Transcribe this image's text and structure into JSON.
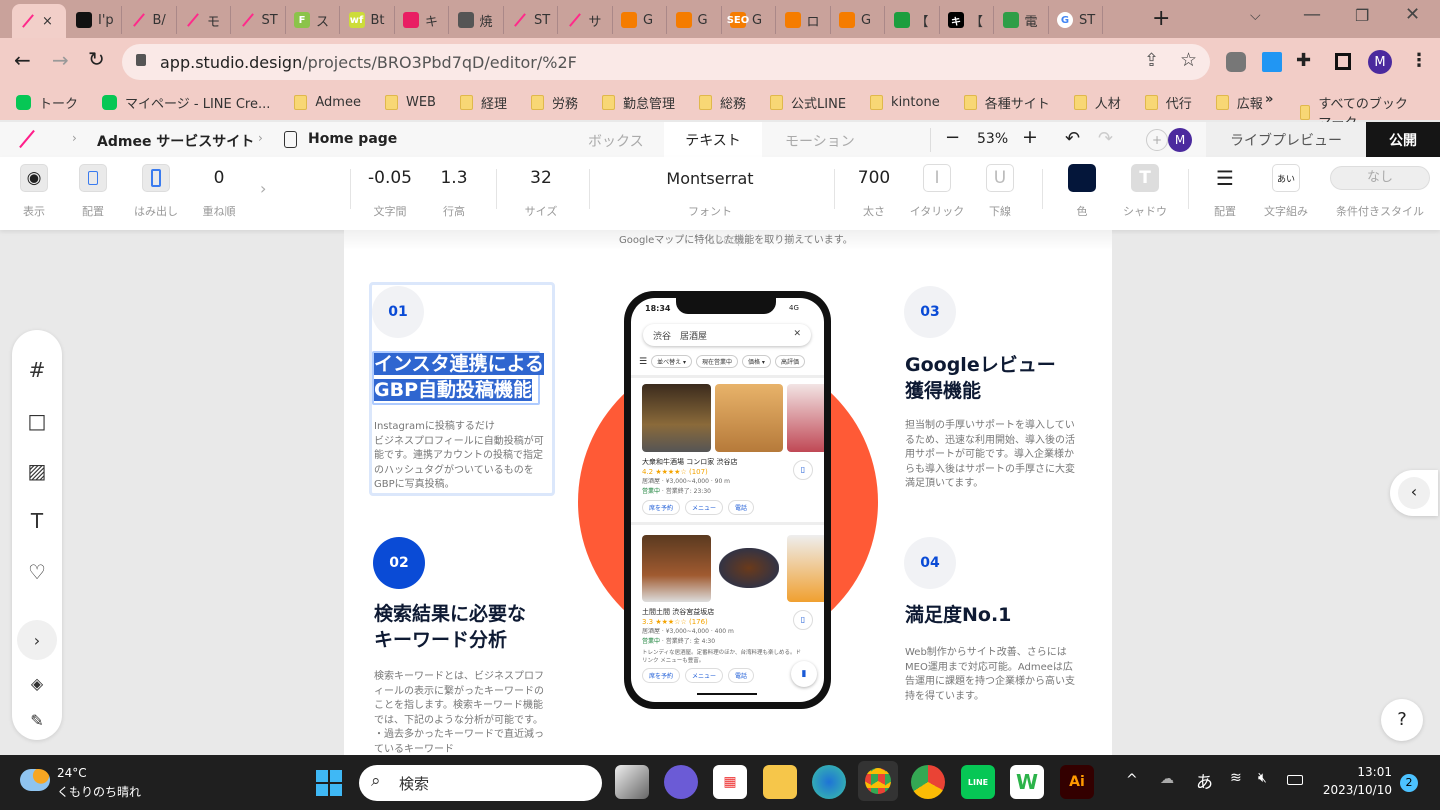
{
  "browser": {
    "tabs": [
      {
        "label": "×",
        "icon": "studio-icon",
        "color": "#ff2a8a"
      },
      {
        "label": "I'p",
        "icon": "dark-site-icon",
        "color": "#111"
      },
      {
        "label": "B/",
        "icon": "studio-icon",
        "color": "#ff2a8a"
      },
      {
        "label": "モ",
        "icon": "studio-icon",
        "color": "#ff2a8a"
      },
      {
        "label": "ST",
        "icon": "studio-icon",
        "color": "#ff2a8a"
      },
      {
        "label": "ス",
        "icon": "F",
        "color": "#8bc34a"
      },
      {
        "label": "Bt",
        "icon": "wf",
        "color": "#cddc39"
      },
      {
        "label": "キ",
        "icon": "pen-icon",
        "color": "#e91e63"
      },
      {
        "label": "焼",
        "icon": "tree-icon",
        "color": "#555"
      },
      {
        "label": "ST",
        "icon": "studio-icon",
        "color": "#ff2a8a"
      },
      {
        "label": "サ",
        "icon": "studio-icon",
        "color": "#ff2a8a"
      },
      {
        "label": "G",
        "icon": "orange-doc-icon",
        "color": "#f57c00"
      },
      {
        "label": "G",
        "icon": "orange-doc-icon",
        "color": "#f57c00"
      },
      {
        "label": "G",
        "icon": "SEO",
        "color": "#f57c00"
      },
      {
        "label": "ロ",
        "icon": "orange-doc-icon",
        "color": "#f57c00"
      },
      {
        "label": "G",
        "icon": "orange-doc-icon",
        "color": "#f57c00"
      },
      {
        "label": "【",
        "icon": "green-cross-icon",
        "color": "#1b9e3e"
      },
      {
        "label": "【",
        "icon": "キ",
        "color": "#000"
      },
      {
        "label": "電",
        "icon": "phone-icon",
        "color": "#2e9e47"
      },
      {
        "label": "ST",
        "icon": "google-icon",
        "color": "#fff"
      }
    ],
    "new_tab": "+",
    "url_host": "app.studio.design",
    "url_path": "/projects/BRO3Pbd7qD/editor/%2F",
    "profile_initial": "M",
    "bookmarks": [
      {
        "label": "トーク",
        "icon": "line-chat-icon"
      },
      {
        "label": "マイページ - LINE Cre...",
        "icon": "line-icon"
      },
      {
        "label": "Admee",
        "icon": "folder-icon"
      },
      {
        "label": "WEB",
        "icon": "folder-icon"
      },
      {
        "label": "経理",
        "icon": "folder-icon"
      },
      {
        "label": "労務",
        "icon": "folder-icon"
      },
      {
        "label": "勤怠管理",
        "icon": "folder-icon"
      },
      {
        "label": "総務",
        "icon": "folder-icon"
      },
      {
        "label": "公式LINE",
        "icon": "folder-icon"
      },
      {
        "label": "kintone",
        "icon": "folder-icon"
      },
      {
        "label": "各種サイト",
        "icon": "folder-icon"
      },
      {
        "label": "人材",
        "icon": "folder-icon"
      },
      {
        "label": "代行",
        "icon": "folder-icon"
      },
      {
        "label": "広報",
        "icon": "folder-icon"
      }
    ],
    "bookmarks_more": "»",
    "all_bookmarks": "すべてのブックマーク"
  },
  "editor": {
    "project": "Admee サービスサイト",
    "page": "Home page",
    "mode_tabs": [
      "ボックス",
      "テキスト",
      "モーション"
    ],
    "active_mode": "テキスト",
    "zoom": "53%",
    "avatar": "M",
    "live_preview": "ライブプレビュー",
    "publish": "公開",
    "toolbar": {
      "display": "表示",
      "placement": "配置",
      "overflow": "はみ出し",
      "z_order_value": "0",
      "z_order": "重ね順",
      "letter_spacing_value": "-0.05",
      "letter_spacing": "文字間",
      "line_height_value": "1.3",
      "line_height": "行高",
      "size_value": "32",
      "size": "サイズ",
      "font_value": "Montserrat",
      "font": "フォント",
      "weight_value": "700",
      "weight": "太さ",
      "italic_glyph": "I",
      "italic": "イタリック",
      "underline_glyph": "U",
      "underline": "下線",
      "color": "色",
      "color_value": "#04163a",
      "shadow_glyph": "T",
      "shadow": "シャドウ",
      "align": "配置",
      "typesetting_glyph": "あい",
      "typesetting": "文字組み",
      "conditional_value": "なし",
      "conditional": "条件付きスタイル"
    }
  },
  "canvas": {
    "top_text": "Googleマップに特化した機能を取り揃えています。",
    "width_label": "1280px",
    "accent": "#ff5a36",
    "features": [
      {
        "num": "01",
        "title_1": "インスタ連携による",
        "title_2": "GBP自動投稿機能",
        "body": "Instagramに投稿するだけ\nビジネスプロフィールに自動投稿が可能です。連携アカウントの投稿で指定のハッシュタグがついているものをGBPに写真投稿。"
      },
      {
        "num": "02",
        "title_1": "検索結果に必要な",
        "title_2": "キーワード分析",
        "body": "検索キーワードとは、ビジネスプロフィールの表示に繋がったキーワードのことを指します。検索キーワード機能では、下記のような分析が可能です。\n・過去多かったキーワードで直近減っているキーワード"
      },
      {
        "num": "03",
        "title_1": "Googleレビュー",
        "title_2": "獲得機能",
        "body": "担当制の手厚いサポートを導入しているため、迅速な利用開始、導入後の活用サポートが可能です。導入企業様からも導入後はサポートの手厚さに大変満足頂いてます。"
      },
      {
        "num": "04",
        "title_1": "満足度No.1",
        "title_2": "",
        "body": "Web制作からサイト改善、さらにはMEO運用まで対応可能。Admeeは広告運用に課題を持つ企業様から高い支持を得ています。"
      }
    ],
    "phone": {
      "time": "18:34",
      "network": "4G",
      "search": "渋谷　居酒屋",
      "filters": [
        "並べ替え ▾",
        "現在営業中",
        "価格 ▾",
        "高評価"
      ],
      "results": [
        {
          "name": "大衆和牛酒場 コンロ家 渋谷店",
          "rating": "4.2 ★★★★☆ (107)",
          "info": "居酒屋 · ¥3,000~4,000 · 90 m",
          "status": "営業中",
          "hours": " · 営業終了: 23:30",
          "desc": ""
        },
        {
          "name": "土間土間 渋谷宮益坂店",
          "rating": "3.3 ★★★☆☆ (176)",
          "info": "居酒屋 · ¥3,000~4,000 · 400 m",
          "status": "営業中",
          "hours": " · 営業終了: 金 4:30",
          "desc": "トレンディな居酒屋。定番料理のほか、台湾料理も楽しめる。ドリンク メニューも豊富。"
        }
      ],
      "actions": [
        "席を予約",
        "メニュー",
        "電話"
      ]
    }
  },
  "help": "?",
  "taskbar": {
    "temp": "24°C",
    "weather": "くもりのち晴れ",
    "search": "検索",
    "time": "13:01",
    "date": "2023/10/10",
    "notifications": "2",
    "ime": "あ",
    "apps": [
      "task-view",
      "teams",
      "store",
      "explorer",
      "edge",
      "chrome-M",
      "chrome-I",
      "LINE",
      "W",
      "Ai"
    ]
  }
}
